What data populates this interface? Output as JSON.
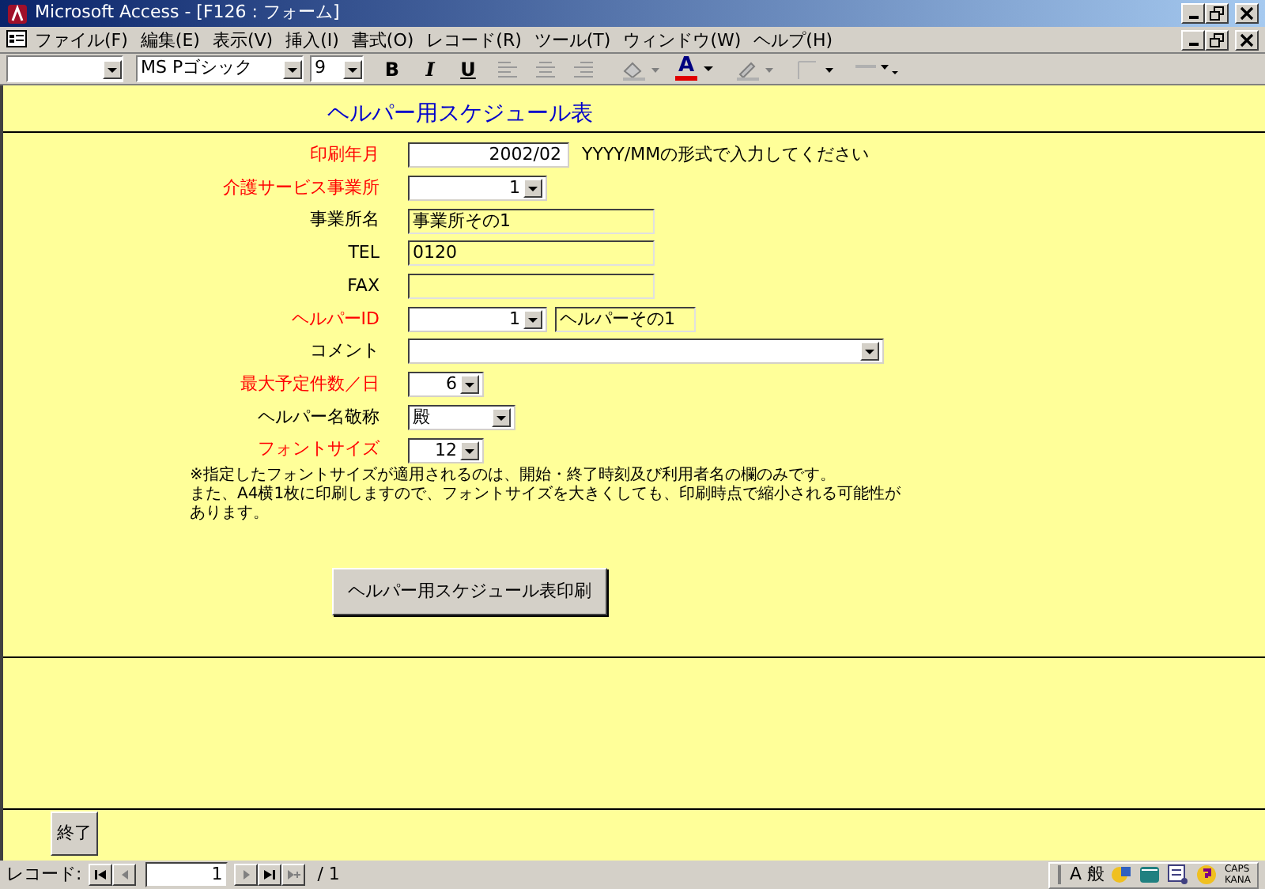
{
  "window": {
    "title": "Microsoft Access - [F126 : フォーム]"
  },
  "menu_bar": [
    "ファイル(F)",
    "編集(E)",
    "表示(V)",
    "挿入(I)",
    "書式(O)",
    "レコード(R)",
    "ツール(T)",
    "ウィンドウ(W)",
    "ヘルプ(H)"
  ],
  "toolbar": {
    "font_name": "MS Pゴシック",
    "font_size": "9",
    "bold": "B",
    "italic": "I",
    "underline": "U",
    "font_color": "A"
  },
  "form": {
    "title": "ヘルパー用スケジュール表",
    "fields": [
      {
        "label": "印刷年月",
        "required": true,
        "kind": "text",
        "numeric": true,
        "value": "2002/02",
        "hint": "YYYY/MMの形式で入力してください"
      },
      {
        "label": "介護サービス事業所",
        "required": true,
        "kind": "combo",
        "numeric": true,
        "value": "1"
      },
      {
        "label": "事業所名",
        "required": false,
        "kind": "display",
        "numeric": false,
        "value": "事業所その1"
      },
      {
        "label": "TEL",
        "required": false,
        "kind": "display",
        "numeric": false,
        "value": "0120"
      },
      {
        "label": "FAX",
        "required": false,
        "kind": "display"
      },
      {
        "label": "ヘルパーID",
        "required": true,
        "kind": "combo",
        "numeric": true,
        "value": "1",
        "extra": "ヘルパーその1"
      },
      {
        "label": "コメント",
        "required": false,
        "kind": "combo"
      },
      {
        "label": "最大予定件数／日",
        "required": true,
        "kind": "combo",
        "numeric": true,
        "value": "6"
      },
      {
        "label": "ヘルパー名敬称",
        "required": false,
        "kind": "combo",
        "numeric": false,
        "value": "殿"
      },
      {
        "label": "フォントサイズ",
        "required": true,
        "kind": "combo",
        "numeric": true,
        "value": "12"
      }
    ],
    "note_lines": [
      "※指定したフォントサイズが適用されるのは、開始・終了時刻及び利用者名の欄のみです。",
      "また、A4横1枚に印刷しますので、フォントサイズを大きくしても、印刷時点で縮小される可能性が",
      "あります。"
    ],
    "print_button": "ヘルパー用スケジュール表印刷",
    "close_button": "終了"
  },
  "record_nav": {
    "label": "レコード:",
    "current": "1",
    "total": "/ 1"
  },
  "ime_bar": {
    "mode": "A 般",
    "caps": "CAPS",
    "kana": "KANA"
  }
}
